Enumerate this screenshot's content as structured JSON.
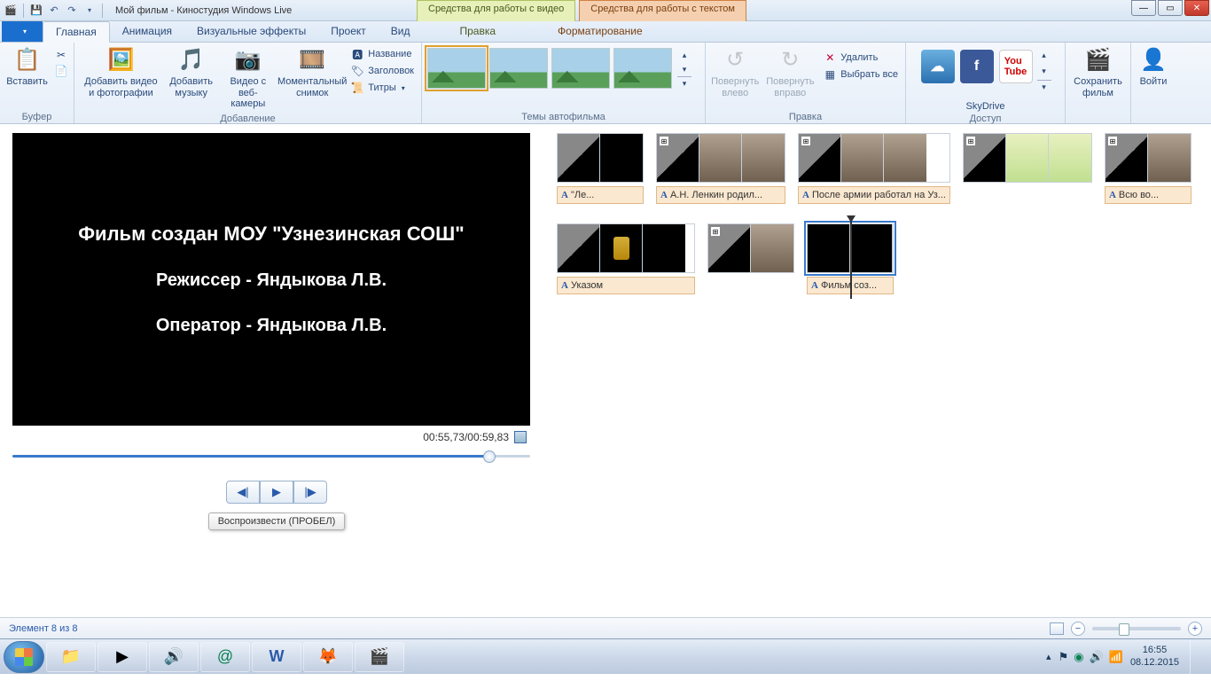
{
  "titlebar": {
    "app_title": "Мой фильм - Киностудия Windows Live",
    "context_video": "Средства для работы с видео",
    "context_text": "Средства для работы с текстом"
  },
  "tabs": {
    "home": "Главная",
    "animation": "Анимация",
    "visual_effects": "Визуальные эффекты",
    "project": "Проект",
    "view": "Вид",
    "edit": "Правка",
    "format": "Форматирование"
  },
  "ribbon": {
    "buffer": {
      "paste": "Вставить",
      "label": "Буфер"
    },
    "adding": {
      "add_video_photo": "Добавить видео и фотографии",
      "add_music": "Добавить музыку",
      "webcam": "Видео с веб-камеры",
      "snapshot": "Моментальный снимок",
      "title": "Название",
      "caption": "Заголовок",
      "credits": "Титры",
      "label": "Добавление"
    },
    "themes": {
      "label": "Темы автофильма"
    },
    "editing": {
      "rotate_left": "Повернуть влево",
      "rotate_right": "Повернуть вправо",
      "delete": "Удалить",
      "select_all": "Выбрать все",
      "label": "Правка"
    },
    "access": {
      "skydrive": "SkyDrive",
      "label": "Доступ"
    },
    "save": "Сохранить фильм",
    "signin": "Войти"
  },
  "preview": {
    "line1": "Фильм создан МОУ \"Узнезинская СОШ\"",
    "line2": "Режиссер - Яндыкова Л.В.",
    "line3": "Оператор - Яндыкова Л.В.",
    "time": "00:55,73/00:59,83",
    "tooltip": "Воспроизвести (ПРОБЕЛ)"
  },
  "clips": {
    "c1": "\"Ле...",
    "c2": "А.Н. Ленкин родил...",
    "c3": "После армии работал на Уз...",
    "c4": "Всю во...",
    "c5": "Указом",
    "c6": "Фильм соз..."
  },
  "caption_prefix": "A",
  "status": {
    "item": "Элемент 8 из 8"
  },
  "tray": {
    "time": "16:55",
    "date": "08.12.2015"
  }
}
